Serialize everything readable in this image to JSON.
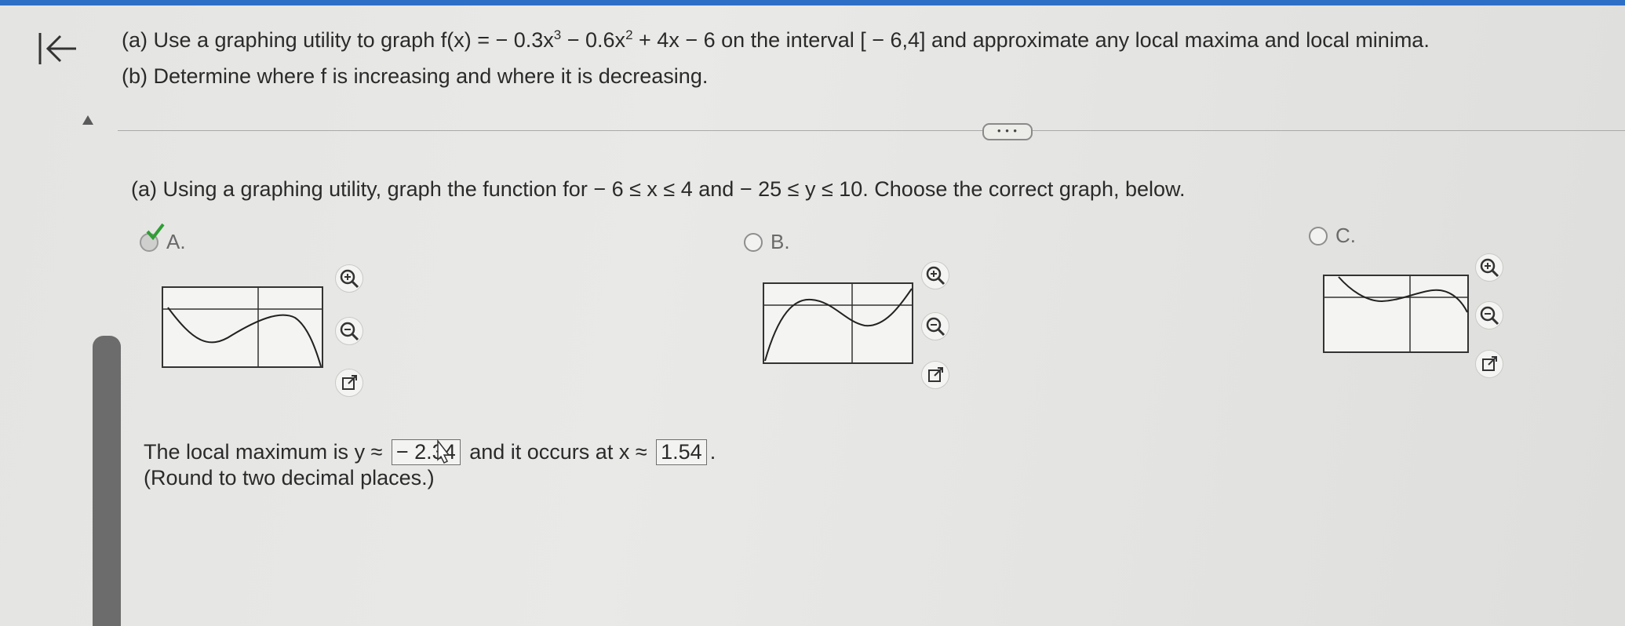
{
  "problem": {
    "part_a_prefix": "(a) Use a graphing utility to graph f(x) = − 0.3x",
    "exp1": "3",
    "part_a_mid": " − 0.6x",
    "exp2": "2",
    "part_a_suffix": " + 4x − 6 on the interval [ − 6,4] and approximate any local maxima and local minima.",
    "part_b": "(b) Determine where f is increasing and where it is decreasing."
  },
  "more_button": "• • •",
  "question": "(a) Using a graphing utility, graph the function for  − 6 ≤ x ≤ 4 and  − 25 ≤ y ≤ 10.  Choose the correct graph, below.",
  "options": [
    {
      "letter": "A.",
      "selected": true
    },
    {
      "letter": "B.",
      "selected": false
    },
    {
      "letter": "C.",
      "selected": false
    }
  ],
  "icons": {
    "back": "first-page-arrow-icon",
    "zoom_in": "zoom-in-icon",
    "zoom_out": "zoom-out-icon",
    "open": "open-new-window-icon",
    "check": "checkmark-icon"
  },
  "answer": {
    "prefix": "The local maximum is y ≈ ",
    "y_value": " − 2.34",
    "middle": " and it occurs at x ≈ ",
    "x_value": "1.54",
    "suffix": ".",
    "note": "(Round to two decimal places.)"
  },
  "colors": {
    "accent": "#2e6fc6",
    "check": "#2f9e35"
  }
}
